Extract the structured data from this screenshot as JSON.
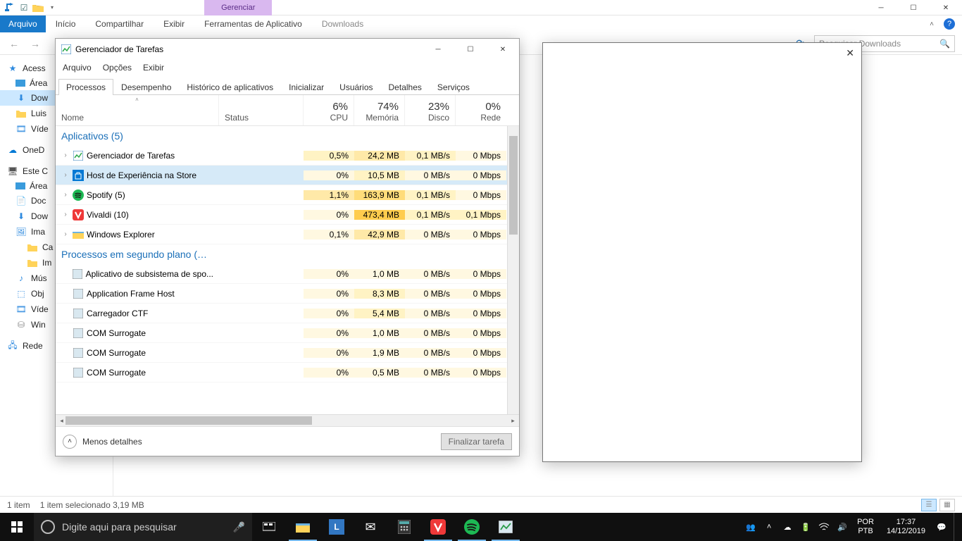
{
  "explorer": {
    "ribbon_context_header": "Gerenciar",
    "ribbon_context_title": "Downloads",
    "tabs": {
      "file": "Arquivo",
      "home": "Início",
      "share": "Compartilhar",
      "view": "Exibir",
      "apptools": "Ferramentas de Aplicativo"
    },
    "search_placeholder": "Pesquisar Downloads",
    "sidebar": {
      "quick": "Acess",
      "desktop": "Área",
      "downloads": "Dow",
      "luis": "Luis",
      "videos": "Víde",
      "onedrive": "OneD",
      "thispc": "Este C",
      "desktop2": "Área",
      "documents": "Doc",
      "downloads2": "Dow",
      "pictures": "Ima",
      "ca": "Ca",
      "im": "Im",
      "music": "Mús",
      "objects3d": "Obj",
      "videos2": "Víde",
      "win": "Win",
      "network": "Rede"
    },
    "status": {
      "items": "1 item",
      "selected": "1 item selecionado  3,19 MB"
    }
  },
  "taskmgr": {
    "title": "Gerenciador de Tarefas",
    "menu": {
      "file": "Arquivo",
      "options": "Opções",
      "view": "Exibir"
    },
    "tabs": {
      "processes": "Processos",
      "performance": "Desempenho",
      "history": "Histórico de aplicativos",
      "startup": "Inicializar",
      "users": "Usuários",
      "details": "Detalhes",
      "services": "Serviços"
    },
    "columns": {
      "name": "Nome",
      "status": "Status",
      "cpu_pct": "6%",
      "cpu": "CPU",
      "mem_pct": "74%",
      "mem": "Memória",
      "disk_pct": "23%",
      "disk": "Disco",
      "net_pct": "0%",
      "net": "Rede"
    },
    "group_apps": "Aplicativos (5)",
    "group_bg": "Processos em segundo plano (…",
    "apps": [
      {
        "name": "Gerenciador de Tarefas",
        "cpu": "0,5%",
        "mem": "24,2 MB",
        "disk": "0,1 MB/s",
        "net": "0 Mbps",
        "icon": "tm"
      },
      {
        "name": "Host de Experiência na Store",
        "cpu": "0%",
        "mem": "10,5 MB",
        "disk": "0 MB/s",
        "net": "0 Mbps",
        "icon": "store",
        "selected": true
      },
      {
        "name": "Spotify (5)",
        "cpu": "1,1%",
        "mem": "163,9 MB",
        "disk": "0,1 MB/s",
        "net": "0 Mbps",
        "icon": "spotify"
      },
      {
        "name": "Vivaldi (10)",
        "cpu": "0%",
        "mem": "473,4 MB",
        "disk": "0,1 MB/s",
        "net": "0,1 Mbps",
        "icon": "vivaldi"
      },
      {
        "name": "Windows Explorer",
        "cpu": "0,1%",
        "mem": "42,9 MB",
        "disk": "0 MB/s",
        "net": "0 Mbps",
        "icon": "explorer"
      }
    ],
    "bg": [
      {
        "name": "Aplicativo de subsistema de spo...",
        "cpu": "0%",
        "mem": "1,0 MB",
        "disk": "0 MB/s",
        "net": "0 Mbps"
      },
      {
        "name": "Application Frame Host",
        "cpu": "0%",
        "mem": "8,3 MB",
        "disk": "0 MB/s",
        "net": "0 Mbps"
      },
      {
        "name": "Carregador CTF",
        "cpu": "0%",
        "mem": "5,4 MB",
        "disk": "0 MB/s",
        "net": "0 Mbps"
      },
      {
        "name": "COM Surrogate",
        "cpu": "0%",
        "mem": "1,0 MB",
        "disk": "0 MB/s",
        "net": "0 Mbps"
      },
      {
        "name": "COM Surrogate",
        "cpu": "0%",
        "mem": "1,9 MB",
        "disk": "0 MB/s",
        "net": "0 Mbps"
      },
      {
        "name": "COM Surrogate",
        "cpu": "0%",
        "mem": "0,5 MB",
        "disk": "0 MB/s",
        "net": "0 Mbps"
      }
    ],
    "fewer_details": "Menos detalhes",
    "end_task": "Finalizar tarefa"
  },
  "taskbar": {
    "search_placeholder": "Digite aqui para pesquisar",
    "lang1": "POR",
    "lang2": "PTB",
    "time": "17:37",
    "date": "14/12/2019"
  }
}
